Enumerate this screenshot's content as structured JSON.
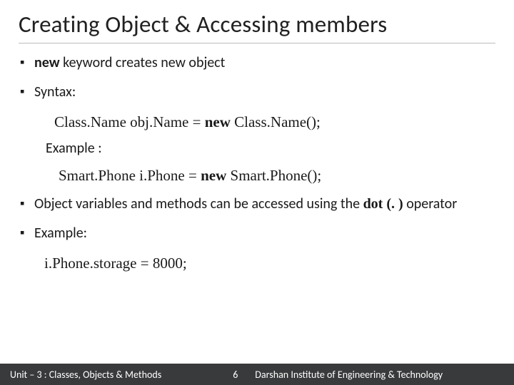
{
  "title": "Creating Object & Accessing members",
  "bullets": {
    "b1_bold": "new",
    "b1_rest": " keyword creates new object",
    "b2": "Syntax:",
    "syntax_line_pre": "Class.Name obj.Name = ",
    "syntax_line_bold": "new",
    "syntax_line_post": " Class.Name();",
    "example_label": "Example :",
    "example_line_pre": "Smart.Phone i.Phone = ",
    "example_line_bold": "new",
    "example_line_post": " Smart.Phone();",
    "b3_pre": "Object variables and methods can be accessed using the ",
    "b3_bold": "dot (. )",
    "b3_post": " operator",
    "b4": "Example:",
    "example2_line": "i.Phone.storage = 8000;"
  },
  "footer": {
    "unit": "Unit – 3  : Classes, Objects & Methods",
    "page": "6",
    "institute": "Darshan Institute of Engineering & Technology"
  }
}
